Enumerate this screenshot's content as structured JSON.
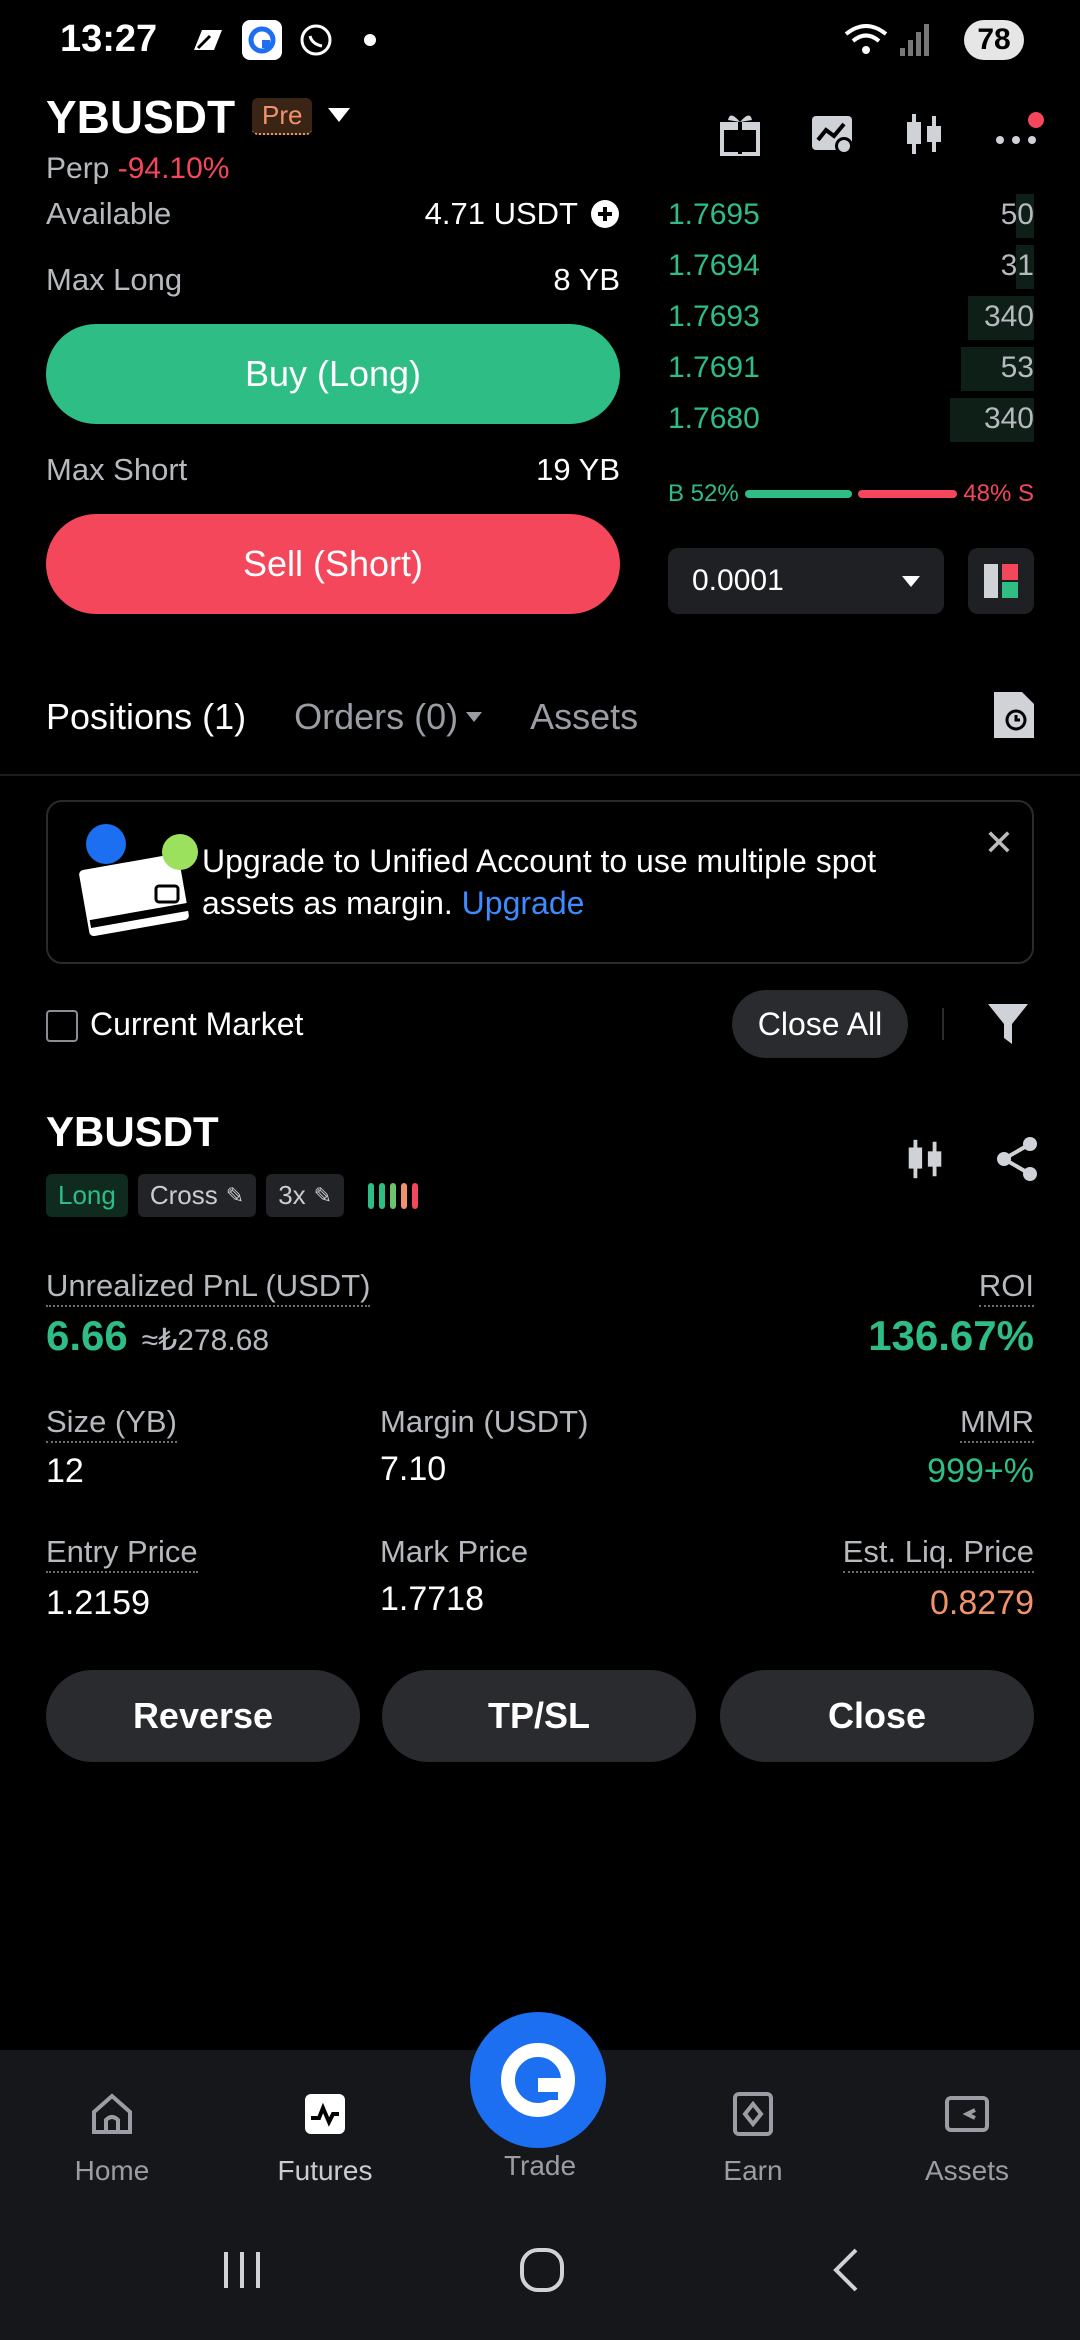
{
  "status_bar": {
    "time": "13:27",
    "battery": "78"
  },
  "header": {
    "symbol": "YBUSDT",
    "badge": "Pre",
    "type": "Perp",
    "change": "-94.10%"
  },
  "trade_panel": {
    "available_label": "Available",
    "available_value": "4.71 USDT",
    "max_long_label": "Max Long",
    "max_long_value": "8 YB",
    "buy_label": "Buy (Long)",
    "max_short_label": "Max Short",
    "max_short_value": "19 YB",
    "sell_label": "Sell (Short)"
  },
  "order_book": {
    "rows": [
      {
        "price": "1.7695",
        "qty": "50",
        "depth": 0.05
      },
      {
        "price": "1.7694",
        "qty": "31",
        "depth": 0.05
      },
      {
        "price": "1.7693",
        "qty": "340",
        "depth": 0.18
      },
      {
        "price": "1.7691",
        "qty": "53",
        "depth": 0.2
      },
      {
        "price": "1.7680",
        "qty": "340",
        "depth": 0.23
      }
    ],
    "buy_ratio": "B 52%",
    "sell_ratio": "48% S",
    "buy_fraction": 0.52,
    "precision": "0.0001"
  },
  "tabs": {
    "positions": "Positions (1)",
    "orders": "Orders (0)",
    "assets": "Assets"
  },
  "banner": {
    "text": "Upgrade to Unified Account to use multiple spot assets as margin.",
    "link": "Upgrade"
  },
  "filter_bar": {
    "current_market": "Current Market",
    "close_all": "Close All"
  },
  "position": {
    "symbol": "YBUSDT",
    "side": "Long",
    "margin_mode": "Cross",
    "leverage": "3x",
    "pnl_label": "Unrealized PnL (USDT)",
    "pnl_value": "6.66",
    "pnl_fiat": "≈₺278.68",
    "roi_label": "ROI",
    "roi_value": "136.67%",
    "size_label": "Size (YB)",
    "size_value": "12",
    "margin_label": "Margin (USDT)",
    "margin_value": "7.10",
    "mmr_label": "MMR",
    "mmr_value": "999+%",
    "entry_label": "Entry Price",
    "entry_value": "1.2159",
    "mark_label": "Mark Price",
    "mark_value": "1.7718",
    "liq_label": "Est. Liq. Price",
    "liq_value": "0.8279",
    "reverse_label": "Reverse",
    "tpsl_label": "TP/SL",
    "close_label": "Close"
  },
  "bottom_nav": {
    "home": "Home",
    "futures": "Futures",
    "trade": "Trade",
    "earn": "Earn",
    "assets": "Assets"
  },
  "colors": {
    "buy": "#2ebd85",
    "sell": "#f5475b",
    "accent": "#1d6ff2",
    "liq": "#f0936a"
  }
}
